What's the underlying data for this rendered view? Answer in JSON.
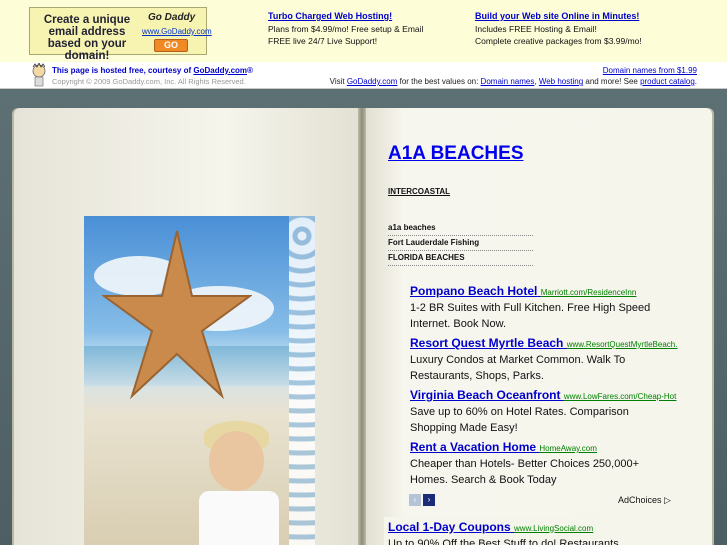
{
  "banner": {
    "promo_text": "Create a unique email address based on your domain!",
    "promo_brand": "Go Daddy",
    "promo_url": "www.GoDaddy.com",
    "promo_go": "GO",
    "ad1": {
      "title": "Turbo Charged Web Hosting!",
      "line1": "Plans from $4.99/mo! Free setup & Email",
      "line2": "FREE live 24/7 Live Support!"
    },
    "ad2": {
      "title": "Build your Web site Online in Minutes!",
      "line1": "Includes FREE Hosting & Email!",
      "line2": "Complete creative packages from $3.99/mo!"
    }
  },
  "host": {
    "hosted_prefix": "This page is hosted free, courtesy of ",
    "hosted_link": "GoDaddy.com",
    "hosted_suffix": "®",
    "copyright": "Copyright © 2009 GoDaddy.com, Inc. All Rights Reserved.",
    "domain_names": "Domain names from $1.99",
    "visit_prefix": "Visit ",
    "visit_link1": "GoDaddy.com",
    "visit_mid1": " for the best values on: ",
    "visit_link2": "Domain names",
    "visit_mid2": ", ",
    "visit_link3": "Web hosting",
    "visit_mid3": " and more! See ",
    "visit_link4": "product catalog",
    "visit_end": "."
  },
  "page": {
    "title": "A1A BEACHES",
    "intercoastal": "INTERCOASTAL",
    "related": [
      "a1a beaches",
      "Fort Lauderdale Fishing",
      "FLORIDA BEACHES"
    ]
  },
  "ads": [
    {
      "title": "Pompano Beach Hotel",
      "url": "Marriott.com/ResidenceInn",
      "desc": "1-2 BR Suites with Full Kitchen. Free High Speed Internet. Book Now."
    },
    {
      "title": "Resort Quest Myrtle Beach",
      "url": "www.ResortQuestMyrtleBeach.",
      "desc": "Luxury Condos at Market Common. Walk To Restaurants, Shops, Parks."
    },
    {
      "title": "Virginia Beach Oceanfront",
      "url": "www.LowFares.com/Cheap-Hot",
      "desc": "Save up to 60% on Hotel Rates. Comparison Shopping Made Easy!"
    },
    {
      "title": "Rent a Vacation Home",
      "url": "HomeAway.com",
      "desc": "Cheaper than Hotels- Better Choices 250,000+ Homes. Search & Book Today"
    }
  ],
  "ad_nav": {
    "prev": "‹",
    "next": "›",
    "adchoices": "AdChoices ▷"
  },
  "bottom_ad": {
    "title": "Local 1-Day Coupons",
    "url": "www.LivingSocial.com",
    "desc": "Up to 90% Off the Best Stuff to do! Restaurants"
  }
}
